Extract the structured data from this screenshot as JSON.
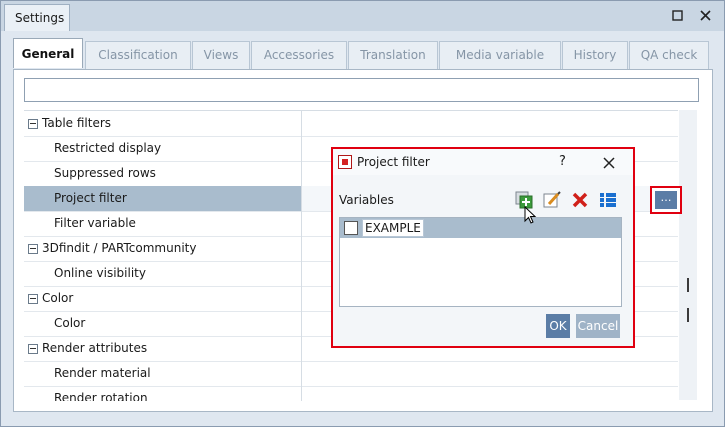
{
  "window": {
    "title": "Settings"
  },
  "tabs": [
    {
      "label": "General",
      "active": true
    },
    {
      "label": "Classification"
    },
    {
      "label": "Views"
    },
    {
      "label": "Accessories"
    },
    {
      "label": "Translation"
    },
    {
      "label": "Media variable"
    },
    {
      "label": "History"
    },
    {
      "label": "QA check"
    }
  ],
  "grid": {
    "rows": [
      {
        "label": "Table filters",
        "group": true
      },
      {
        "label": "Restricted display"
      },
      {
        "label": "Suppressed rows"
      },
      {
        "label": "Project filter",
        "selected": true
      },
      {
        "label": "Filter variable"
      },
      {
        "label": "3Dfindit / PARTcommunity",
        "group": true
      },
      {
        "label": "Online visibility"
      },
      {
        "label": "Color",
        "group": true
      },
      {
        "label": "Color"
      },
      {
        "label": "Render attributes",
        "group": true
      },
      {
        "label": "Render material"
      },
      {
        "label": "Render rotation"
      }
    ]
  },
  "dialog": {
    "title": "Project filter",
    "help": "?",
    "variables_label": "Variables",
    "items": [
      {
        "label": "EXAMPLE",
        "checked": false
      }
    ],
    "ok": "OK",
    "cancel": "Cancel"
  },
  "icons": {
    "add": "add-variable-icon",
    "edit": "edit-variable-icon",
    "delete": "delete-variable-icon",
    "list": "list-view-icon"
  },
  "colors": {
    "highlight": "#e00010",
    "accent": "#5b7da6",
    "selection": "#a9bccd"
  }
}
